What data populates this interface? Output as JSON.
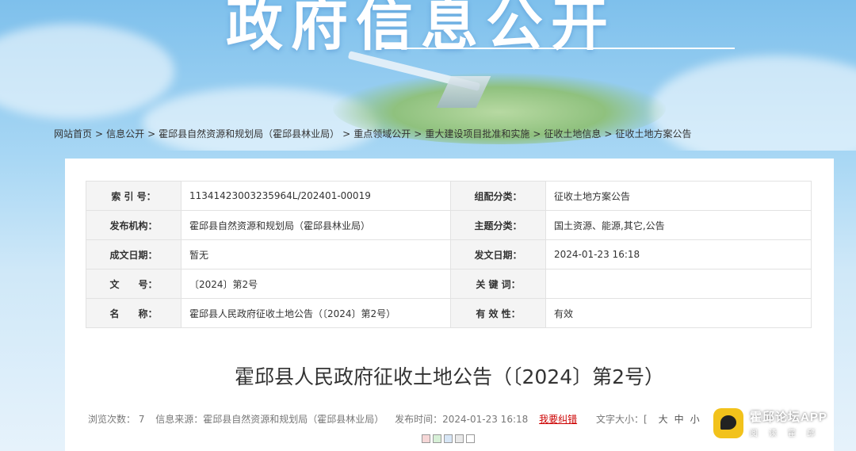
{
  "banner": {
    "title": "政府信息公开"
  },
  "breadcrumb": [
    "网站首页",
    "信息公开",
    "霍邱县自然资源和规划局（霍邱县林业局）",
    "重点领域公开",
    "重大建设项目批准和实施",
    "征收土地信息",
    "征收土地方案公告"
  ],
  "meta": {
    "index_label": "索 引 号：",
    "index_value": "11341423003235964L/202401-00019",
    "category_label": "组配分类：",
    "category_value": "征收土地方案公告",
    "publisher_label": "发布机构：",
    "publisher_value": "霍邱县自然资源和规划局（霍邱县林业局）",
    "topic_label": "主题分类：",
    "topic_value": "国土资源、能源,其它,公告",
    "created_label": "成文日期：",
    "created_value": "暂无",
    "published_label": "发文日期：",
    "published_value": "2024-01-23 16:18",
    "docno_label": "文　　号：",
    "docno_value": "〔2024〕第2号",
    "keywords_label": "关 键 词：",
    "keywords_value": "",
    "name_label": "名　　称：",
    "name_value": "霍邱县人民政府征收土地公告（〔2024〕第2号）",
    "validity_label": "有 效 性：",
    "validity_value": "有效"
  },
  "article": {
    "title": "霍邱县人民政府征收土地公告（〔2024〕第2号）",
    "views": "浏览次数： 7",
    "source": "信息来源：霍邱县自然资源和规划局（霍邱县林业局）",
    "time": "发布时间：2024-01-23 16:18",
    "report": "我要纠错",
    "font_size_label": "文字大小：[",
    "font_large": "大",
    "font_medium": "中",
    "font_small": "小"
  },
  "swatch_colors": [
    "#f6d7d7",
    "#d7f0d7",
    "#d7e6f6",
    "#e9e9e9",
    "#ffffff"
  ],
  "watermark": {
    "name": "霍邱论坛APP",
    "sub": "阅读霍邱"
  }
}
